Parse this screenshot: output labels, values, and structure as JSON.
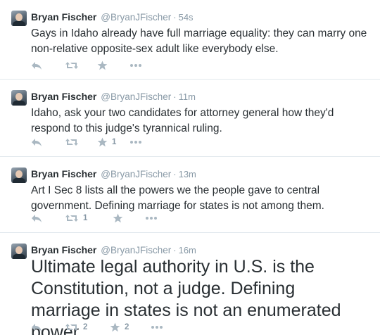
{
  "tweets": [
    {
      "name": "Bryan Fischer",
      "handle": "@BryanJFischer",
      "separator": "·",
      "time": "54s",
      "text": "Gays in Idaho already have full marriage equality: they can marry one non-relative opposite-sex adult like everybody else.",
      "retweets": "",
      "favorites": ""
    },
    {
      "name": "Bryan Fischer",
      "handle": "@BryanJFischer",
      "separator": "·",
      "time": "11m",
      "text": "Idaho, ask your two candidates for attorney general how they'd respond to this judge's tyrannical ruling.",
      "retweets": "",
      "favorites": "1"
    },
    {
      "name": "Bryan Fischer",
      "handle": "@BryanJFischer",
      "separator": "·",
      "time": "13m",
      "text": "Art I Sec 8 lists all the powers we the people gave to central government. Defining marriage for states is not among them.",
      "retweets": "1",
      "favorites": ""
    },
    {
      "name": "Bryan Fischer",
      "handle": "@BryanJFischer",
      "separator": "·",
      "time": "16m",
      "text": "Ultimate legal authority in U.S. is the Constitution, not a judge. Defining marriage in states is not an enumerated power.",
      "retweets": "2",
      "favorites": "2"
    }
  ],
  "icons": {
    "reply": "reply-icon",
    "retweet": "retweet-icon",
    "favorite": "star-icon",
    "more": "more-icon"
  },
  "colors": {
    "text": "#292f33",
    "muted": "#8899a6",
    "icon": "#aab8c2",
    "divider": "#e1e8ed"
  }
}
